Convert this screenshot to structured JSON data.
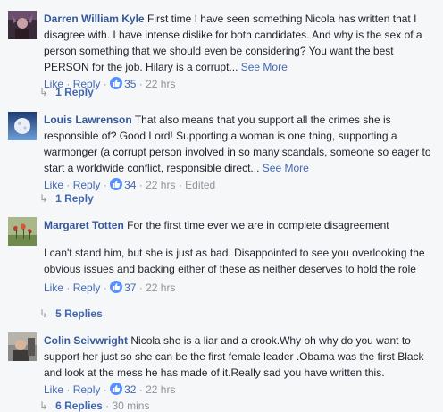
{
  "comments": [
    {
      "author": "Darren William Kyle",
      "paragraphs": [
        "First time I have seen something Nicola has written that I disagree with. I have intense dislike for both candidates. And why is the sex of a person something that we should even be considering? You want the best PERSON for the job. Hilary is a corrupt..."
      ],
      "see_more": "See More",
      "like": "Like",
      "reply": "Reply",
      "reactions": "35",
      "time": "22 hrs",
      "edited": "",
      "replies_label": "1 Reply",
      "replies_time": ""
    },
    {
      "author": "Louis Lawrenson",
      "paragraphs": [
        "That also means that you support all the crimes she is responsible of? Good Lord! Supporting a woman is one thing, supporting a warmonger (a corrupt person involved in so many scandals, someone so eager to start a worldwide conflict, responsible direct..."
      ],
      "see_more": "See More",
      "like": "Like",
      "reply": "Reply",
      "reactions": "34",
      "time": "22 hrs",
      "edited": "Edited",
      "replies_label": "1 Reply",
      "replies_time": ""
    },
    {
      "author": "Margaret Totten",
      "paragraphs": [
        "For the first time ever we are in complete disagreement",
        "I can't stand him, but she is just as bad. Disappointed to see you overlooking the obvious issues and backing either of these as neither deserves to hold the role"
      ],
      "see_more": "",
      "like": "Like",
      "reply": "Reply",
      "reactions": "37",
      "time": "22 hrs",
      "edited": "",
      "replies_label": "5 Replies",
      "replies_time": ""
    },
    {
      "author": "Colin Seivwright",
      "paragraphs": [
        "Nicola she is a liar and a crook.Why oh why do you want to support her just so she can be the first female leader .Obama was the first Black and look at the mess he has made of it.Really sad you have written this."
      ],
      "see_more": "",
      "like": "Like",
      "reply": "Reply",
      "reactions": "32",
      "time": "22 hrs",
      "edited": "",
      "replies_label": "6 Replies",
      "replies_time": "30 mins"
    }
  ],
  "separator": "·",
  "reply_arrow": "↳",
  "colors": {
    "background": "#f6f7f9",
    "name": "#365899",
    "link": "#4267b2",
    "meta": "#90949c",
    "like_badge": "#5890ff"
  },
  "icons": {
    "like_reaction": "thumbs-up-icon",
    "reply_arrow": "reply-arrow-icon"
  }
}
